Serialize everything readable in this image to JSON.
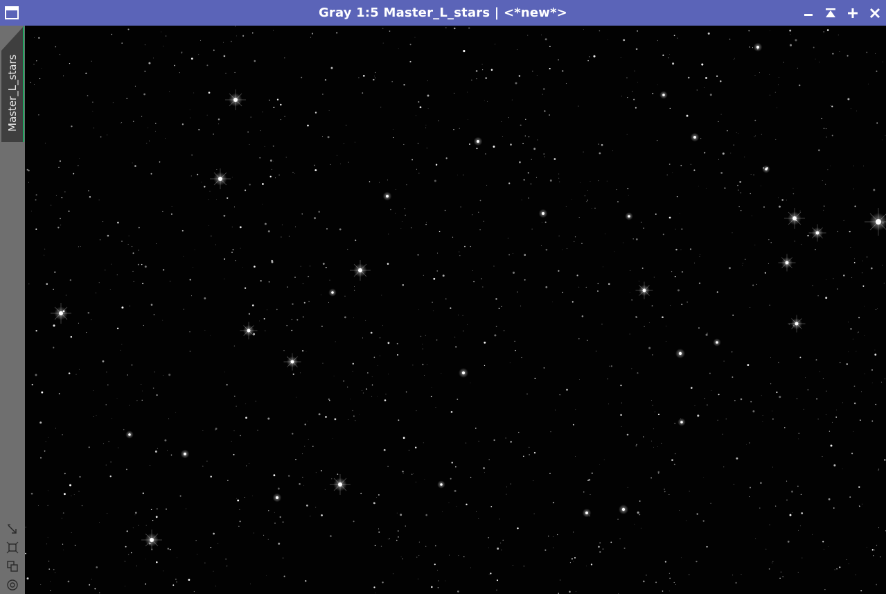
{
  "window": {
    "title": "Gray 1:5 Master_L_stars | <*new*>",
    "titlebar_color": "#5b64b8",
    "buttons": {
      "minimize_icon": "minimize-icon",
      "shade_icon": "shade-icon",
      "maximize_icon": "maximize-icon",
      "close_icon": "close-icon"
    }
  },
  "sidebar": {
    "view_tab_label": "Master_L_stars",
    "tab_accent_color": "#1fa861",
    "tools": [
      "fit-view-icon",
      "zoom-to-fit-icon",
      "clone-view-icon",
      "target-icon"
    ]
  },
  "image": {
    "description_kind": "starfield",
    "background_color": "#020202"
  }
}
